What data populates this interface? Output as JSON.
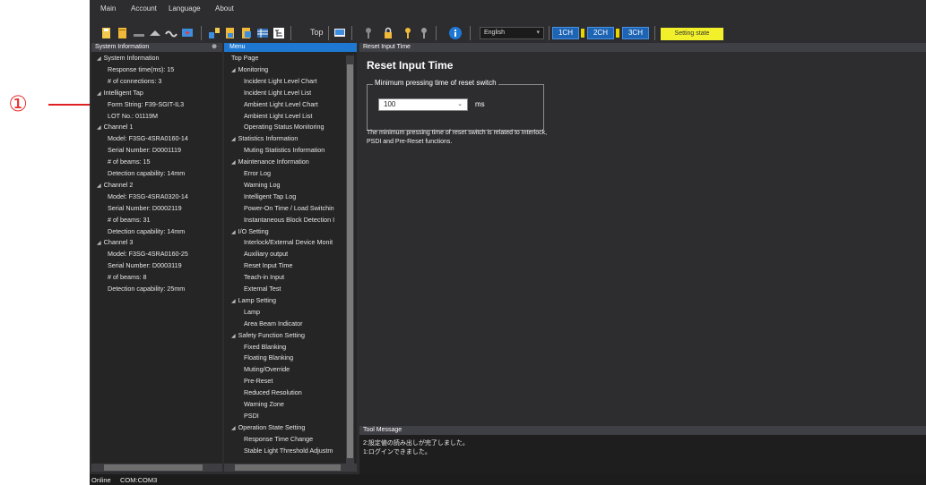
{
  "annotation": {
    "marker": "①"
  },
  "menubar": {
    "items": [
      "Main",
      "Account",
      "Language",
      "About"
    ]
  },
  "toolbar": {
    "top_label": "Top",
    "language": "English",
    "channels": [
      "1CH",
      "2CH",
      "3CH"
    ],
    "setting_state": "Setting state",
    "icons": [
      "save-icon",
      "open-icon",
      "bluetooth-icon",
      "sensor-icon",
      "wave-icon",
      "monitor-icon",
      "upload-icon",
      "download-icon",
      "compare-icon",
      "table-icon",
      "tree-icon",
      "home-icon",
      "lock-icon",
      "key-icon",
      "key-alt-icon",
      "info-icon"
    ]
  },
  "system_info": {
    "header": "System Information",
    "pin": "⊕",
    "rows": [
      {
        "text": "System Information",
        "level": 0,
        "expander": true
      },
      {
        "text": "Response time(ms): 15",
        "level": 1
      },
      {
        "text": "# of connections: 3",
        "level": 1
      },
      {
        "text": "Intelligent Tap",
        "level": 0,
        "expander": true
      },
      {
        "text": "Form String: F39-SGIT-IL3",
        "level": 1
      },
      {
        "text": "LOT No.: 01119M",
        "level": 1
      },
      {
        "text": "Channel 1",
        "level": 0,
        "expander": true
      },
      {
        "text": "Model: F3SG-4SRA0160-14",
        "level": 1
      },
      {
        "text": "Serial Number: D0001119",
        "level": 1
      },
      {
        "text": "# of beams: 15",
        "level": 1
      },
      {
        "text": "Detection capability: 14mm",
        "level": 1
      },
      {
        "text": "Channel 2",
        "level": 0,
        "expander": true
      },
      {
        "text": "Model: F3SG-4SRA0320-14",
        "level": 1
      },
      {
        "text": "Serial Number: D0002119",
        "level": 1
      },
      {
        "text": "# of beams: 31",
        "level": 1
      },
      {
        "text": "Detection capability: 14mm",
        "level": 1
      },
      {
        "text": "Channel 3",
        "level": 0,
        "expander": true
      },
      {
        "text": "Model: F3SG-4SRA0160-25",
        "level": 1
      },
      {
        "text": "Serial Number: D0003119",
        "level": 1
      },
      {
        "text": "# of beams: 8",
        "level": 1
      },
      {
        "text": "Detection capability: 25mm",
        "level": 1
      }
    ]
  },
  "menu": {
    "header": "Menu",
    "rows": [
      {
        "text": "Top Page",
        "level": 0
      },
      {
        "text": "Monitoring",
        "level": 0,
        "expander": true
      },
      {
        "text": "Incident Light Level Chart",
        "level": 1
      },
      {
        "text": "Incident Light Level List",
        "level": 1
      },
      {
        "text": "Ambient Light Level Chart",
        "level": 1
      },
      {
        "text": "Ambient Light Level List",
        "level": 1
      },
      {
        "text": "Operating Status Monitoring",
        "level": 1
      },
      {
        "text": "Statistics Information",
        "level": 0,
        "expander": true
      },
      {
        "text": "Muting Statistics Information",
        "level": 1
      },
      {
        "text": "Maintenance Information",
        "level": 0,
        "expander": true
      },
      {
        "text": "Error Log",
        "level": 1
      },
      {
        "text": "Warning Log",
        "level": 1
      },
      {
        "text": "Intelligent Tap Log",
        "level": 1
      },
      {
        "text": "Power-On Time / Load Switchin",
        "level": 1
      },
      {
        "text": "Instantaneous Block Detection I",
        "level": 1
      },
      {
        "text": "I/O Setting",
        "level": 0,
        "expander": true
      },
      {
        "text": "Interlock/External Device Monit",
        "level": 1
      },
      {
        "text": "Auxiliary output",
        "level": 1
      },
      {
        "text": "Reset Input Time",
        "level": 1
      },
      {
        "text": "Teach-in Input",
        "level": 1
      },
      {
        "text": "External Test",
        "level": 1
      },
      {
        "text": "Lamp Setting",
        "level": 0,
        "expander": true
      },
      {
        "text": "Lamp",
        "level": 1
      },
      {
        "text": "Area Beam Indicator",
        "level": 1
      },
      {
        "text": "Safety Function Setting",
        "level": 0,
        "expander": true
      },
      {
        "text": "Fixed Blanking",
        "level": 1
      },
      {
        "text": "Floating Blanking",
        "level": 1
      },
      {
        "text": "Muting/Override",
        "level": 1
      },
      {
        "text": "Pre-Reset",
        "level": 1
      },
      {
        "text": "Reduced Resolution",
        "level": 1
      },
      {
        "text": "Warning Zone",
        "level": 1
      },
      {
        "text": "PSDI",
        "level": 1
      },
      {
        "text": "Operation State Setting",
        "level": 0,
        "expander": true
      },
      {
        "text": "Response Time Change",
        "level": 1
      },
      {
        "text": "Stable Light Threshold Adjustm",
        "level": 1
      }
    ]
  },
  "main": {
    "tab_header": "Reset Input Time",
    "title": "Reset Input Time",
    "group_label": "Minimum pressing time of reset switch",
    "value": "100",
    "unit": "ms",
    "description_1": "The minimum pressing time of reset switch is related to Interlock,",
    "description_2": "PSDI and Pre-Reset functions."
  },
  "tool_message": {
    "header": "Tool Message",
    "lines": [
      "2:設定値の読み出しが完了しました。",
      "1:ログインできました。"
    ]
  },
  "status": {
    "state": "Online",
    "port": "COM:COM3"
  }
}
